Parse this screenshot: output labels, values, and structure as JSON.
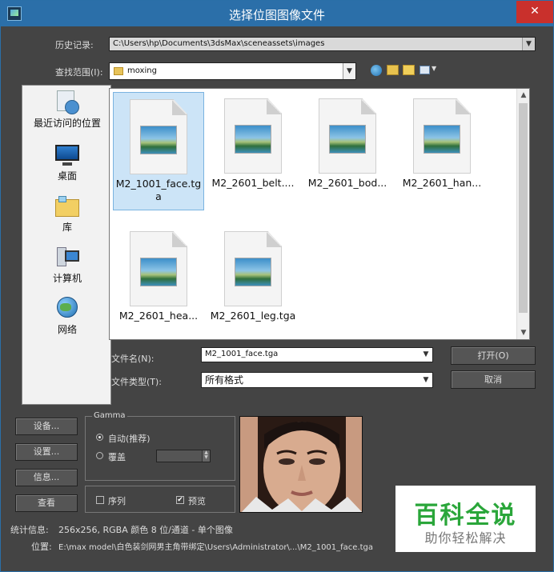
{
  "window": {
    "title": "选择位图图像文件",
    "close_glyph": "✕",
    "accent": "#2b6fa9",
    "close_color": "#c9302c"
  },
  "history": {
    "label": "历史记录:",
    "value": "C:\\Users\\hp\\Documents\\3dsMax\\sceneassets\\images"
  },
  "lookin": {
    "label": "查找范围(I):",
    "value": "moxing"
  },
  "places": [
    {
      "label": "最近访问的位置",
      "icon": "recent-places-icon"
    },
    {
      "label": "桌面",
      "icon": "desktop-icon"
    },
    {
      "label": "库",
      "icon": "libraries-icon"
    },
    {
      "label": "计算机",
      "icon": "computer-icon"
    },
    {
      "label": "网络",
      "icon": "network-icon"
    }
  ],
  "files": [
    {
      "name": "M2_1001_face.tga",
      "selected": true
    },
    {
      "name": "M2_2601_belt....",
      "selected": false
    },
    {
      "name": "M2_2601_bod...",
      "selected": false
    },
    {
      "name": "M2_2601_han...",
      "selected": false
    },
    {
      "name": "M2_2601_hea...",
      "selected": false
    },
    {
      "name": "M2_2601_leg.tga",
      "selected": false
    }
  ],
  "filename": {
    "label": "文件名(N):",
    "value": "M2_1001_face.tga"
  },
  "filetype": {
    "label": "文件类型(T):",
    "value": "所有格式"
  },
  "buttons": {
    "open": "打开(O)",
    "cancel": "取消",
    "setup1": "设备...",
    "setup2": "设置...",
    "info": "信息...",
    "view": "查看"
  },
  "gamma": {
    "title": "Gamma",
    "auto_label": "自动(推荐)",
    "override_label": "覆盖",
    "override_value": ""
  },
  "options": {
    "sequence_label": "序列",
    "preview_label": "预览",
    "preview_checked": "✔"
  },
  "status": {
    "stats_label": "统计信息:",
    "stats_value": "256x256, RGBA 颜色 8 位/通道 - 单个图像",
    "location_label": "位置:",
    "location_value": "E:\\max model\\白色装剑网男主角带绑定\\Users\\Administrator\\...\\M2_1001_face.tga"
  },
  "watermark": {
    "line1": "百科全说",
    "line2": "助你轻松解决"
  }
}
